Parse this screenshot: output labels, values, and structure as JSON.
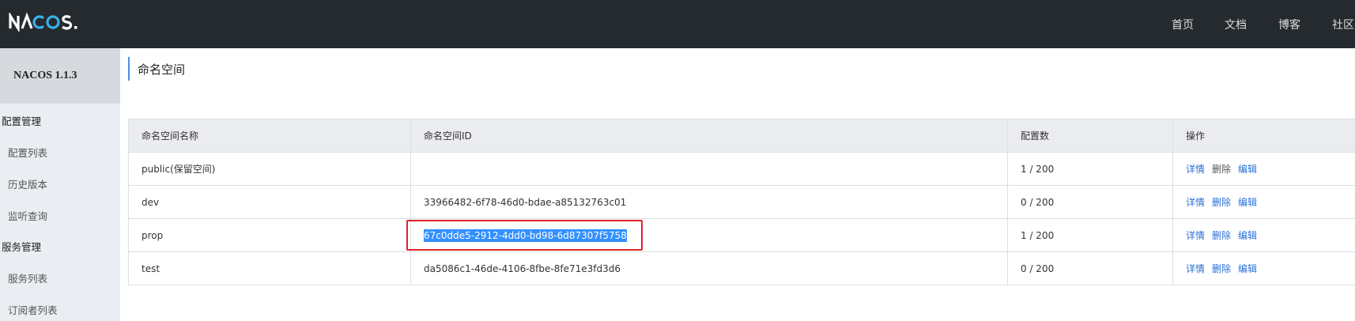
{
  "header": {
    "logo_text": "NACOS.",
    "nav": [
      {
        "label": "首页"
      },
      {
        "label": "文档"
      },
      {
        "label": "博客"
      },
      {
        "label": "社区"
      }
    ]
  },
  "sidebar": {
    "version": "NACOS 1.1.3",
    "groups": [
      {
        "label": "配置管理",
        "items": [
          "配置列表",
          "历史版本",
          "监听查询"
        ]
      },
      {
        "label": "服务管理",
        "items": [
          "服务列表",
          "订阅者列表"
        ]
      }
    ]
  },
  "main": {
    "title": "命名空间",
    "table": {
      "columns": [
        "命名空间名称",
        "命名空间ID",
        "配置数",
        "操作"
      ],
      "rows": [
        {
          "name": "public(保留空间)",
          "id": "",
          "count": "1 / 200"
        },
        {
          "name": "dev",
          "id": "33966482-6f78-46d0-bdae-a85132763c01",
          "count": "0 / 200"
        },
        {
          "name": "prop",
          "id": "67c0dde5-2912-4dd0-bd98-6d87307f5758",
          "count": "1 / 200"
        },
        {
          "name": "test",
          "id": "da5086c1-46de-4106-8fbe-8fe71e3fd3d6",
          "count": "0 / 200"
        }
      ],
      "ops": {
        "detail": "详情",
        "delete": "删除",
        "edit": "编辑"
      }
    }
  },
  "colors": {
    "topbar": "#252a2f",
    "sidebar": "#eaedf1",
    "link": "#2a6fd6",
    "highlight_box": "#e0232a",
    "selection": "#3390ff"
  }
}
